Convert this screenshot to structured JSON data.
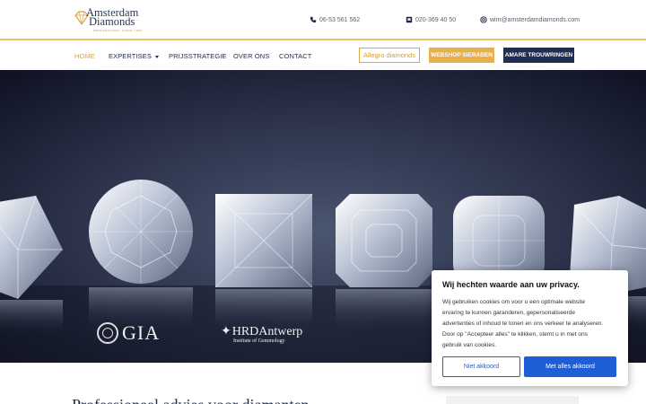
{
  "header": {
    "logo_line1": "Amsterdam",
    "logo_line2": "Diamonds",
    "logo_sub": "PROFESSIONAL SINCE 1984",
    "phone": "06-53 561 562",
    "fax": "020-369 40 50",
    "email": "wim@amsterdamdiamonds.com"
  },
  "nav": {
    "items": [
      {
        "label": "HOME",
        "active": true
      },
      {
        "label": "EXPERTISES",
        "active": false
      },
      {
        "label": "PRIJSSTRATEGIE",
        "active": false
      },
      {
        "label": "OVER ONS",
        "active": false
      },
      {
        "label": "CONTACT",
        "active": false
      }
    ],
    "btn_allegro": "Allegro diamonds",
    "btn_webshop": "WEBSHOP SIERADEN",
    "btn_amare": "AMARE TROUWRINGEN"
  },
  "hero": {
    "gia_label": "GIA",
    "hrd_label": "HRDAntwerp",
    "hrd_sub": "Institute of Gemmology"
  },
  "below": {
    "heading": "Professioneel advies voor diamanten"
  },
  "cookie": {
    "title": "Wij hechten waarde aan uw privacy.",
    "lines": [
      "Wij gebruiken cookies om voor u een optimale website",
      "ervaring te kunnen garanderen, gepersonaliseerde",
      "advertenties of inhoud te tonen en ons verkeer te analyseren.",
      "Door op \"Accepteer alles\" te klikken, stemt u in met ons",
      "gebruik van cookies."
    ],
    "reject_label": "Niet akkoord",
    "accept_label": "Met alles akkoord"
  },
  "colors": {
    "gold": "#e8b04a",
    "navy": "#1f2e52",
    "cookie_blue": "#1d5fd6"
  }
}
